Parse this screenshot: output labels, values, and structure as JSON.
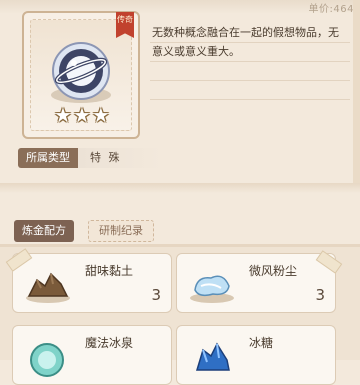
{
  "header": {
    "score_prefix": "单价:",
    "score_value": "464"
  },
  "item": {
    "rarity_tag": "传奇",
    "stars": [
      "★",
      "★",
      "★"
    ],
    "icon": "void-orb-icon",
    "description": "无数种概念融合在一起的假想物品，无意义或意义重大。",
    "category_label": "所属类型",
    "category_value": "特 殊"
  },
  "tabs": [
    {
      "label": "炼金配方",
      "active": true
    },
    {
      "label": "研制纪录",
      "active": false
    }
  ],
  "recipes": [
    {
      "name": "甜味黏土",
      "qty": "3",
      "icon": "clay-icon"
    },
    {
      "name": "微风粉尘",
      "qty": "3",
      "icon": "dust-icon"
    },
    {
      "name": "魔法冰泉",
      "qty": "",
      "icon": "ice-spring-icon"
    },
    {
      "name": "冰糖",
      "qty": "",
      "icon": "rock-sugar-icon"
    }
  ],
  "colors": {
    "background": "#f3e9dc",
    "accent_tab": "#7d6252",
    "rarity_red": "#c1422e"
  }
}
